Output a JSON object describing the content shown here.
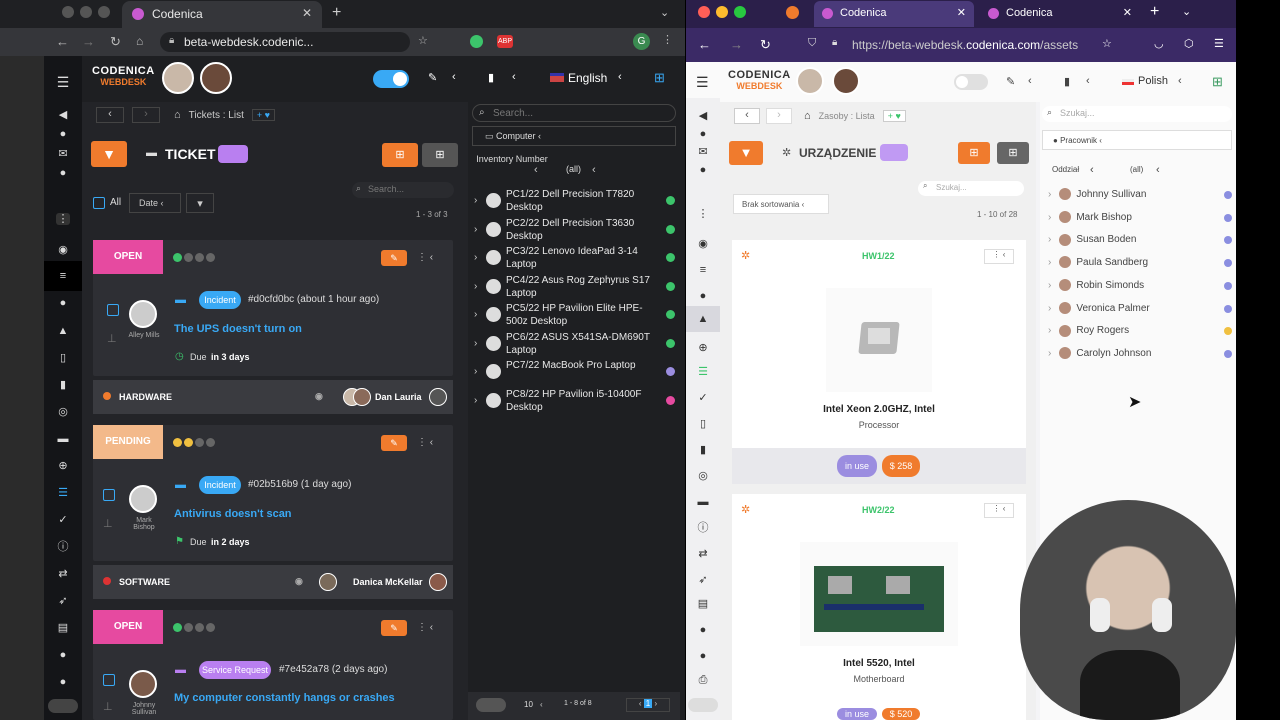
{
  "left_browser": {
    "tab_title": "Codenica",
    "url": "beta-webdesk.codenic...",
    "app": {
      "logo_line1": "CODENICA",
      "logo_line2": "WEBDESK",
      "language": "English",
      "breadcrumb": "Tickets : List",
      "page_title": "TICKET",
      "all_label": "All",
      "sort_label": "Date",
      "search_placeholder": "Search...",
      "count": "1 - 3 of 3",
      "tickets": [
        {
          "status": "OPEN",
          "status_color": "#e64aa0",
          "type": "Incident",
          "ref": "#d0cfd0bc (about 1 hour ago)",
          "user": "Alley Mills",
          "title": "The UPS doesn't turn on",
          "due_prefix": "Due",
          "due": "in 3 days",
          "category": "HARDWARE",
          "assignee": "Dan Lauria"
        },
        {
          "status": "PENDING",
          "status_color": "#f3b98a",
          "type": "Incident",
          "ref": "#02b516b9 (1 day ago)",
          "user": "Mark Bishop",
          "title": "Antivirus doesn't scan",
          "due_prefix": "Due",
          "due": "in 2 days",
          "category": "SOFTWARE",
          "assignee": "Danica McKellar"
        },
        {
          "status": "OPEN",
          "status_color": "#e64aa0",
          "type": "Service Request",
          "ref": "#7e452a78 (2 days ago)",
          "user": "Johnny Sullivan",
          "title": "My computer constantly hangs or crashes"
        }
      ],
      "panel": {
        "search_placeholder": "Search...",
        "filter": "Computer",
        "col_header": "Inventory Number",
        "col_value": "(all)",
        "items": [
          {
            "text": "PC1/22 Dell Precision T7820 Desktop",
            "dot": "#3cc46b"
          },
          {
            "text": "PC2/22 Dell Precision T3630 Desktop",
            "dot": "#3cc46b"
          },
          {
            "text": "PC3/22 Lenovo IdeaPad 3-14 Laptop",
            "dot": "#3cc46b"
          },
          {
            "text": "PC4/22 Asus Rog Zephyrus S17 Laptop",
            "dot": "#3cc46b"
          },
          {
            "text": "PC5/22 HP Pavilion Elite HPE-500z Desktop",
            "dot": "#3cc46b"
          },
          {
            "text": "PC6/22 ASUS X541SA-DM690T Laptop",
            "dot": "#3cc46b"
          },
          {
            "text": "PC7/22 MacBook Pro Laptop",
            "dot": "#9b8de0"
          },
          {
            "text": "PC8/22 HP Pavilion i5-10400F Desktop",
            "dot": "#e64aa0"
          }
        ],
        "page_size": "10",
        "pager": "1 - 8 of 8",
        "page": "1"
      }
    }
  },
  "right_browser": {
    "tab1": "Codenica",
    "tab2": "Codenica",
    "url_host": "https://beta-webdesk.",
    "url_domain": "codenica.com",
    "url_path": "/assets",
    "app": {
      "logo_line1": "CODENICA",
      "logo_line2": "WEBDESK",
      "language": "Polish",
      "breadcrumb": "Zasoby : Lista",
      "page_title": "URZĄDZENIE",
      "sort_label": "Brak sortowania",
      "search_placeholder": "Szukaj...",
      "count": "1 - 10 of 28",
      "assets": [
        {
          "code": "HW1/22",
          "name": "Intel Xeon 2.0GHZ, Intel",
          "type": "Processor",
          "status": "in use",
          "price": "$ 258"
        },
        {
          "code": "HW2/22",
          "name": "Intel 5520, Intel",
          "type": "Motherboard",
          "status": "in use",
          "price": "$ 520"
        }
      ],
      "panel": {
        "search_placeholder": "Szukaj...",
        "filter": "Pracownik",
        "col_header": "Oddział",
        "col_value": "(all)",
        "people": [
          {
            "name": "Johnny Sullivan",
            "dot": "#8a8ee0"
          },
          {
            "name": "Mark Bishop",
            "dot": "#8a8ee0"
          },
          {
            "name": "Susan Boden",
            "dot": "#8a8ee0"
          },
          {
            "name": "Paula Sandberg",
            "dot": "#8a8ee0"
          },
          {
            "name": "Robin Simonds",
            "dot": "#8a8ee0"
          },
          {
            "name": "Veronica Palmer",
            "dot": "#8a8ee0"
          },
          {
            "name": "Roy Rogers",
            "dot": "#f0c040"
          },
          {
            "name": "Carolyn Johnson",
            "dot": "#8a8ee0"
          }
        ]
      }
    }
  }
}
